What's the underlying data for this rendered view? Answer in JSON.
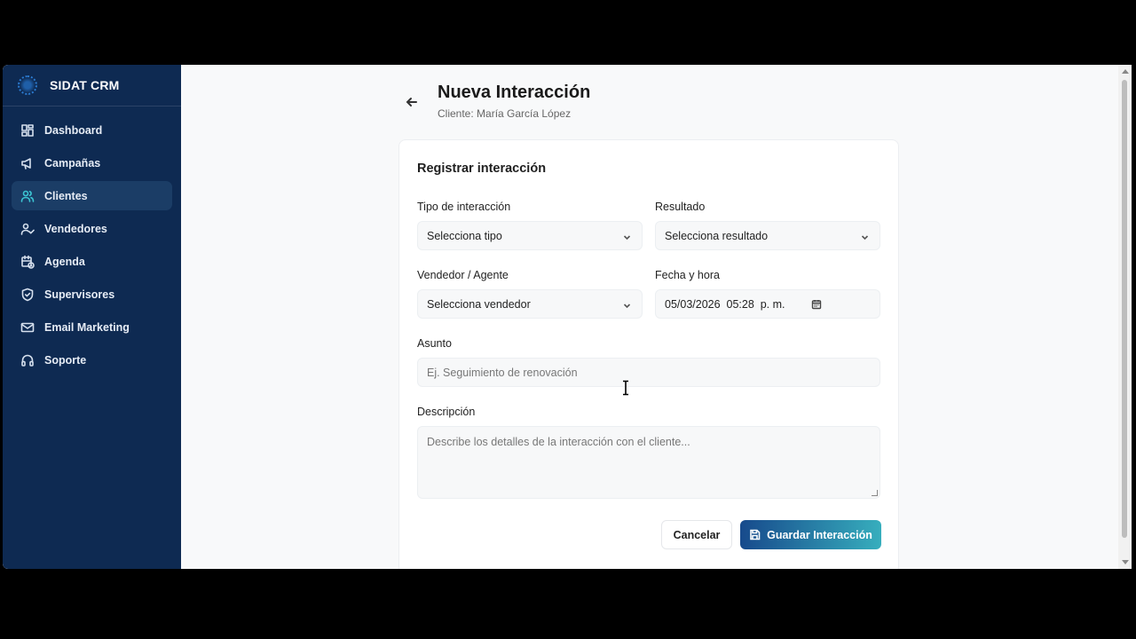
{
  "app": {
    "name": "SIDAT CRM"
  },
  "sidebar": {
    "items": [
      {
        "label": "Dashboard",
        "icon": "dashboard-icon"
      },
      {
        "label": "Campañas",
        "icon": "megaphone-icon"
      },
      {
        "label": "Clientes",
        "icon": "users-icon",
        "active": true
      },
      {
        "label": "Vendedores",
        "icon": "user-check-icon"
      },
      {
        "label": "Agenda",
        "icon": "calendar-clock-icon"
      },
      {
        "label": "Supervisores",
        "icon": "shield-icon"
      },
      {
        "label": "Email Marketing",
        "icon": "mail-icon"
      },
      {
        "label": "Soporte",
        "icon": "headphones-icon"
      }
    ]
  },
  "header": {
    "title": "Nueva Interacción",
    "subtitle": "Cliente: María García López"
  },
  "form": {
    "title": "Registrar interacción",
    "tipo": {
      "label": "Tipo de interacción",
      "value": "Selecciona tipo"
    },
    "resultado": {
      "label": "Resultado",
      "value": "Selecciona resultado"
    },
    "vendedor": {
      "label": "Vendedor / Agente",
      "value": "Selecciona vendedor"
    },
    "fecha": {
      "label": "Fecha y hora",
      "value": "05/03/2026  05:28  p. m."
    },
    "asunto": {
      "label": "Asunto",
      "placeholder": "Ej. Seguimiento de renovación"
    },
    "descripcion": {
      "label": "Descripción",
      "placeholder": "Describe los detalles de la interacción con el cliente..."
    },
    "cancel_label": "Cancelar",
    "save_label": "Guardar Interacción"
  },
  "colors": {
    "sidebar_bg": "#0e2a52",
    "active_item_bg": "#1b3d66",
    "accent": "#37aebd",
    "primary": "#174a8c"
  }
}
